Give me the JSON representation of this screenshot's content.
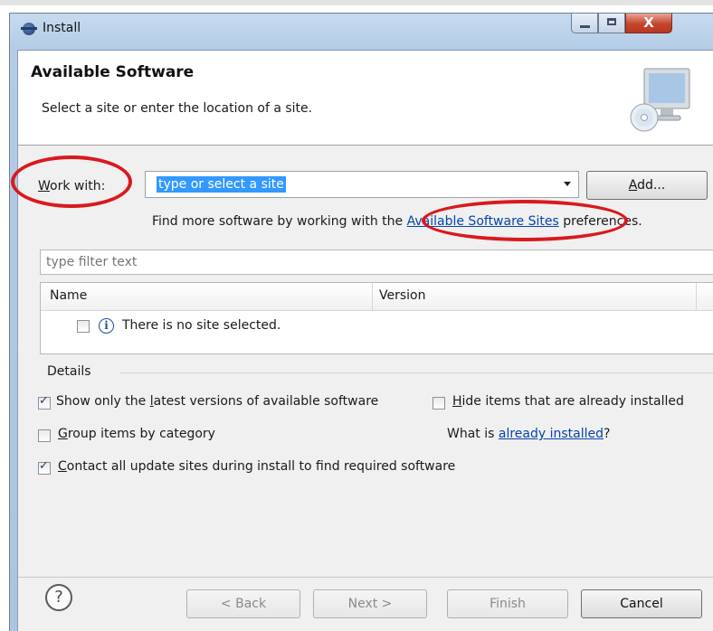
{
  "window": {
    "title": "Install",
    "close_glyph": "X"
  },
  "header": {
    "title": "Available Software",
    "description": "Select a site or enter the location of a site.",
    "banner_icon": "software-install-monitor-cd-icon"
  },
  "work_with": {
    "label_prefix": "W",
    "label_rest": "ork with:",
    "selected_text": "type or select a site",
    "add_label_prefix": "A",
    "add_label_rest": "dd..."
  },
  "find_more": {
    "text_before": "Find more software by working with the ",
    "link": "Available Software Sites",
    "text_after": " preferences."
  },
  "filter": {
    "placeholder": "type filter text"
  },
  "tree": {
    "columns": [
      "Name",
      "Version"
    ],
    "empty_message": "There is no site selected."
  },
  "details": {
    "label": "Details",
    "options": [
      {
        "before": "Show only the ",
        "mnemonic": "l",
        "after": "atest versions of available software",
        "checked": true
      },
      {
        "before": "",
        "mnemonic": "H",
        "after": "ide items that are already installed",
        "checked": false
      },
      {
        "before": "",
        "mnemonic": "G",
        "after": "roup items by category",
        "checked": false
      },
      {
        "before": "",
        "mnemonic": "C",
        "after": "ontact all update sites during install to find required software",
        "checked": true
      }
    ],
    "what_is_prefix": "What is ",
    "what_is_link": "already installed",
    "what_is_suffix": "?"
  },
  "footer": {
    "help_glyph": "?",
    "back_label": "< Back",
    "next_label": "Next >",
    "finish_label": "Finish",
    "cancel_label": "Cancel"
  },
  "annotations": {
    "highlight_color": "#d9191d"
  }
}
